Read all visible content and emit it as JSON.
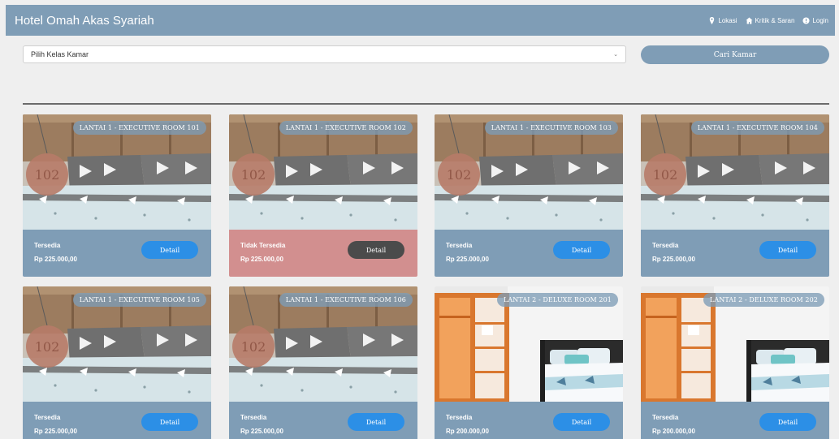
{
  "navbar": {
    "brand": "Hotel Omah Akas Syariah",
    "links": [
      {
        "label": "Lokasi",
        "icon": "map-pin-icon"
      },
      {
        "label": "Kritik & Saran",
        "icon": "home-icon"
      },
      {
        "label": "Login",
        "icon": "sign-in-icon"
      }
    ]
  },
  "search": {
    "select_value": "Pilih Kelas Kamar",
    "button_label": "Cari Kamar"
  },
  "colors": {
    "accent": "#7f9db6",
    "detail_button": "#2c8fe6",
    "unavailable": "#d28f8f",
    "detail_button_disabled": "#4b4b4b"
  },
  "rooms": [
    {
      "title": "LANTAI 1 - EXECUTIVE ROOM 101",
      "status": "Tersedia",
      "price": "Rp 225.000,00",
      "detail_label": "Detail",
      "available": true,
      "photo": "executive",
      "room_tag": "102"
    },
    {
      "title": "LANTAI 1 - EXECUTIVE ROOM 102",
      "status": "Tidak Tersedia",
      "price": "Rp 225.000,00",
      "detail_label": "Detail",
      "available": false,
      "photo": "executive",
      "room_tag": "102"
    },
    {
      "title": "LANTAI 1 - EXECUTIVE ROOM 103",
      "status": "Tersedia",
      "price": "Rp 225.000,00",
      "detail_label": "Detail",
      "available": true,
      "photo": "executive",
      "room_tag": "102"
    },
    {
      "title": "LANTAI 1 - EXECUTIVE ROOM 104",
      "status": "Tersedia",
      "price": "Rp 225.000,00",
      "detail_label": "Detail",
      "available": true,
      "photo": "executive",
      "room_tag": "102"
    },
    {
      "title": "LANTAI 1 - EXECUTIVE ROOM 105",
      "status": "Tersedia",
      "price": "Rp 225.000,00",
      "detail_label": "Detail",
      "available": true,
      "photo": "executive",
      "room_tag": "102"
    },
    {
      "title": "LANTAI 1 - EXECUTIVE ROOM 106",
      "status": "Tersedia",
      "price": "Rp 225.000,00",
      "detail_label": "Detail",
      "available": true,
      "photo": "executive",
      "room_tag": "102"
    },
    {
      "title": "LANTAI 2 - DELUXE ROOM 201",
      "status": "Tersedia",
      "price": "Rp 200.000,00",
      "detail_label": "Detail",
      "available": true,
      "photo": "deluxe",
      "room_tag": ""
    },
    {
      "title": "LANTAI 2 - DELUXE ROOM 202",
      "status": "Tersedia",
      "price": "Rp 200.000,00",
      "detail_label": "Detail",
      "available": true,
      "photo": "deluxe",
      "room_tag": ""
    }
  ]
}
